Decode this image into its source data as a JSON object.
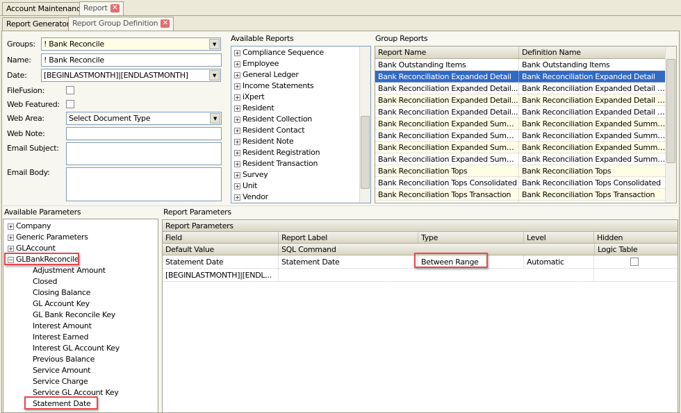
{
  "tabs": [
    {
      "label": "Account Maintenance"
    },
    {
      "label": "Report"
    }
  ],
  "subtabs": [
    {
      "label": "Report Generator"
    },
    {
      "label": "Report Group Definition"
    }
  ],
  "form": {
    "groups_label": "Groups:",
    "groups_value": "! Bank Reconcile",
    "name_label": "Name:",
    "name_value": "! Bank Reconcile",
    "date_label": "Date:",
    "date_value": "[BEGINLASTMONTH]|[ENDLASTMONTH]",
    "filefusion_label": "FileFusion:",
    "filefusion_checked": false,
    "webfeatured_label": "Web Featured:",
    "webfeatured_checked": false,
    "webarea_label": "Web Area:",
    "webarea_value": "Select Document Type",
    "webnote_label": "Web Note:",
    "webnote_value": "",
    "emailsubject_label": "Email Subject:",
    "emailsubject_value": "",
    "emailbody_label": "Email Body:",
    "emailbody_value": ""
  },
  "available_reports": {
    "title": "Available Reports",
    "items": [
      "Compliance Sequence",
      "Employee",
      "General Ledger",
      "Income Statements",
      "iXpert",
      "Resident",
      "Resident Collection",
      "Resident Contact",
      "Resident Note",
      "Resident Registration",
      "Resident Transaction",
      "Survey",
      "Unit",
      "Vendor"
    ]
  },
  "group_reports": {
    "title": "Group Reports",
    "columns": [
      "Report Name",
      "Definition Name"
    ],
    "rows": [
      [
        "Bank Outstanding Items",
        "Bank Outstanding Items"
      ],
      [
        "Bank Reconciliation Expanded Detail",
        "Bank Reconciliation Expanded Detail"
      ],
      [
        "Bank  Reconciliation  Expanded  Detail...",
        "Bank  Reconciliation  Expanded  Detail  C..."
      ],
      [
        "Bank  Reconciliation  Expanded  Detail...",
        "Bank  Reconciliation  Expanded  Detail  C..."
      ],
      [
        "Bank  Reconciliation  Expanded  Detail...",
        "Bank  Reconciliation  Expanded  Detail  T..."
      ],
      [
        "Bank  Reconciliation  Expanded  Summ...",
        "Bank  Reconciliation  Expanded  Summa..."
      ],
      [
        "Bank  Reconciliation  Expanded  Summ...",
        "Bank  Reconciliation  Expanded  Summa..."
      ],
      [
        "Bank  Reconciliation  Expanded  Summ...",
        "Bank  Reconciliation  Expanded  Summa..."
      ],
      [
        "Bank  Reconciliation  Expanded  Summ...",
        "Bank  Reconciliation  Expanded  Summa..."
      ],
      [
        "Bank Reconciliation Tops",
        "Bank Reconciliation Tops"
      ],
      [
        "Bank Reconciliation Tops Consolidated",
        "Bank Reconciliation Tops Consolidated"
      ],
      [
        "Bank Reconciliation Tops Transaction",
        "Bank Reconciliation Tops Transaction"
      ]
    ],
    "selected_index": 1
  },
  "available_parameters": {
    "title": "Available Parameters",
    "groups": [
      {
        "label": "Company",
        "expanded": false
      },
      {
        "label": "Generic Parameters",
        "expanded": false
      },
      {
        "label": "GLAccount",
        "expanded": false
      },
      {
        "label": "GLBankReconcile",
        "expanded": true
      }
    ],
    "children": [
      "Adjustment Amount",
      "Closed",
      "Closing Balance",
      "GL Account Key",
      "GL Bank Reconcile Key",
      "Interest Amount",
      "Interest Earned",
      "Interest GL Account Key",
      "Previous Balance",
      "Service Amount",
      "Service Charge",
      "Service GL Account Key",
      "Statement Date"
    ]
  },
  "report_parameters": {
    "title": "Report Parameters",
    "band_title": "Report Parameters",
    "header1": [
      "Field",
      "Report Label",
      "Type",
      "Level",
      "Hidden"
    ],
    "header2": [
      "Default Value",
      "SQL Command",
      "",
      "",
      "Logic Table"
    ],
    "row1": [
      "Statement Date",
      "Statement Date",
      "Between Range",
      "Automatic"
    ],
    "row1_hidden": false,
    "row2": [
      "[BEGINLASTMONTH]|[ENDL..."
    ]
  },
  "colors": {
    "selection": "#316ac5",
    "highlight_box": "#e8474e",
    "alt_row": "#fffde6"
  }
}
